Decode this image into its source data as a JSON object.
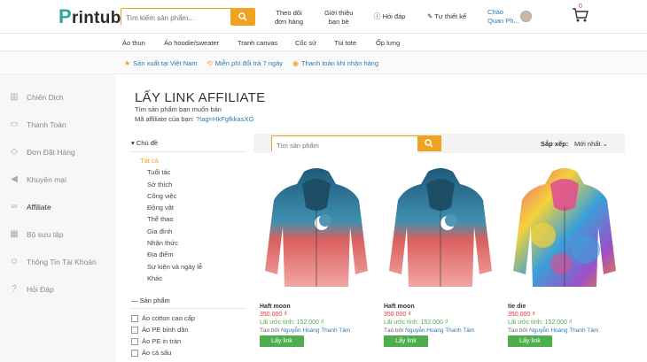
{
  "header": {
    "logo": "rintub",
    "logo_letter": "P",
    "search_placeholder": "Tìm kiếm sản phẩm...",
    "links": [
      {
        "line1": "Theo dõi",
        "line2": "đơn hàng"
      },
      {
        "line1": "Giới thiệu",
        "line2": "bạn bè"
      },
      {
        "line1": "Hỏi đáp",
        "line2": ""
      },
      {
        "line1": "Tự thiết kế",
        "line2": ""
      }
    ],
    "greeting_line1": "Chào",
    "greeting_line2": "Quan Ph...",
    "cart_count": "0"
  },
  "categories": [
    "Áo thun",
    "Áo hoodie/sweater",
    "Tranh canvas",
    "Cốc sứ",
    "Túi tote",
    "Ốp lưng"
  ],
  "benefits": [
    "Sản xuất tại Việt Nam",
    "Miễn phí đổi trả 7 ngày",
    "Thanh toán khi nhận hàng"
  ],
  "sidebar": [
    {
      "label": "Chiến Dịch",
      "icon": "chart-icon"
    },
    {
      "label": "Thanh Toán",
      "icon": "card-icon"
    },
    {
      "label": "Đơn Đặt Hàng",
      "icon": "tag-icon"
    },
    {
      "label": "Khuyến mại",
      "icon": "megaphone-icon"
    },
    {
      "label": "Affiliate",
      "icon": "link-icon"
    },
    {
      "label": "Bộ sưu tập",
      "icon": "grid-icon"
    },
    {
      "label": "Thông Tin Tài Khoản",
      "icon": "user-icon"
    },
    {
      "label": "Hỏi Đáp",
      "icon": "question-icon"
    }
  ],
  "main": {
    "title": "LẤY LINK AFFILIATE",
    "subtitle": "Tìm sản phẩm bạn muốn bán",
    "aff_label": "Mã affiliate của bạn: ",
    "aff_code": "?tag=HkFgfkkasXG"
  },
  "filters": {
    "topics_title": "Chủ đề",
    "topics": [
      "Tất cả",
      "Tuổi tác",
      "Sở thích",
      "Công việc",
      "Động vật",
      "Thể thao",
      "Gia đình",
      "Nhận thức",
      "Địa điểm",
      "Sự kiện và ngày lễ",
      "Khác"
    ],
    "products_title": "Sản phẩm",
    "products": [
      "Áo cotton cao cấp",
      "Áo PE bình dân",
      "Áo PE in tràn",
      "Áo cá sấu"
    ]
  },
  "product_search": {
    "placeholder": "Tìm sản phẩm",
    "sort_label": "Sắp xếp:",
    "sort_value": "Mới nhất"
  },
  "products": [
    {
      "name": "Haft moon",
      "price": "350.000 ₫",
      "profit": "Lãi ước tính: 152.000 ₫",
      "author_prefix": "Tạo bởi ",
      "author": "Nguyễn Hoàng Thanh Tâm",
      "button": "Lấy link"
    },
    {
      "name": "Haft moon",
      "price": "350.000 ₫",
      "profit": "Lãi ước tính: 152.000 ₫",
      "author_prefix": "Tạo bởi ",
      "author": "Nguyễn Hoàng Thanh Tâm",
      "button": "Lấy link"
    },
    {
      "name": "tie die",
      "price": "350.000 ₫",
      "profit": "Lãi ước tính: 152.000 ₫",
      "author_prefix": "Tạo bởi ",
      "author": "Nguyễn Hoàng Thanh Tâm",
      "button": "Lấy link"
    }
  ],
  "colors": {
    "accent": "#f0a322",
    "brand": "#27a8a0",
    "link": "#2a7ab8",
    "price": "#e0333a",
    "button": "#4cae4c"
  }
}
